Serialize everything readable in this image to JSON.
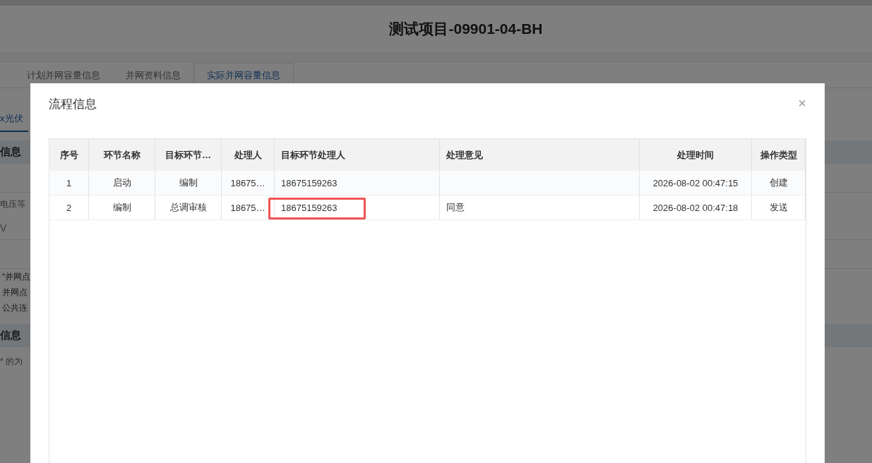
{
  "page": {
    "title": "测试项目-09901-04-BH",
    "tabs": [
      {
        "label": "计划并网容量信息",
        "selected": false
      },
      {
        "label": "并网资料信息",
        "selected": false
      },
      {
        "label": "实际并网容量信息",
        "selected": true
      }
    ],
    "sub_tab": {
      "label": "x光伏",
      "selected": true
    },
    "sections": [
      {
        "kind": "header",
        "text": "信息"
      },
      {
        "kind": "blank"
      },
      {
        "kind": "label",
        "text": "电压等"
      },
      {
        "kind": "value",
        "text": "V"
      },
      {
        "kind": "blank"
      },
      {
        "kind": "note",
        "text": "“并网点"
      },
      {
        "kind": "note",
        "text": "并网点"
      },
      {
        "kind": "note",
        "text": "公共连"
      },
      {
        "kind": "header",
        "text": "信息"
      },
      {
        "kind": "hint",
        "text": "* 的为"
      }
    ]
  },
  "dialog": {
    "title": "流程信息",
    "close": "×",
    "table": {
      "columns": [
        "序号",
        "环节名称",
        "目标环节…",
        "处理人",
        "目标环节处理人",
        "处理意见",
        "处理时间",
        "操作类型"
      ],
      "rows": [
        [
          "1",
          "启动",
          "编制",
          "18675…",
          "18675159263",
          "",
          "2026-08-02 00:47:15",
          "创建"
        ],
        [
          "2",
          "编制",
          "总调审核",
          "18675…",
          "18675159263",
          "同意",
          "2026-08-02 00:47:18",
          "发送"
        ]
      ]
    }
  }
}
